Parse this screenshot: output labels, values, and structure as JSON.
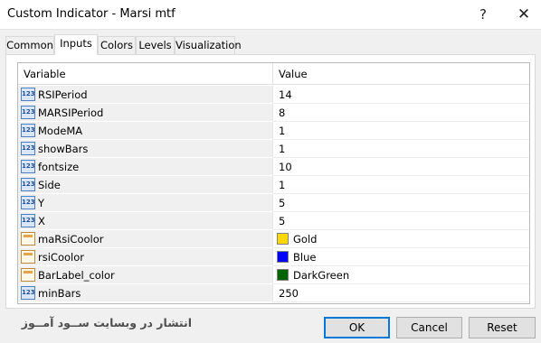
{
  "window": {
    "title": "Custom Indicator - Marsi mtf",
    "help_label": "?",
    "close_label": "✕"
  },
  "tabs": [
    {
      "label": "Common"
    },
    {
      "label": "Inputs",
      "active": true
    },
    {
      "label": "Colors"
    },
    {
      "label": "Levels"
    },
    {
      "label": "Visualization"
    }
  ],
  "grid": {
    "header_variable": "Variable",
    "header_value": "Value",
    "rows": [
      {
        "icon": "numeric-param-icon",
        "icon_text": "123",
        "name": "RSIPeriod",
        "value": "14"
      },
      {
        "icon": "numeric-param-icon",
        "icon_text": "123",
        "name": "MARSIPeriod",
        "value": "8"
      },
      {
        "icon": "numeric-param-icon",
        "icon_text": "123",
        "name": "ModeMA",
        "value": "1"
      },
      {
        "icon": "numeric-param-icon",
        "icon_text": "123",
        "name": "showBars",
        "value": "1"
      },
      {
        "icon": "numeric-param-icon",
        "icon_text": "123",
        "name": "fontsize",
        "value": "10"
      },
      {
        "icon": "numeric-param-icon",
        "icon_text": "123",
        "name": "Side",
        "value": "1"
      },
      {
        "icon": "numeric-param-icon",
        "icon_text": "123",
        "name": "Y",
        "value": "5"
      },
      {
        "icon": "numeric-param-icon",
        "icon_text": "123",
        "name": "X",
        "value": "5"
      },
      {
        "icon": "color-param-icon",
        "name": "maRsiCoolor",
        "value": "Gold",
        "color": "#ffd700"
      },
      {
        "icon": "color-param-icon",
        "name": "rsiCoolor",
        "value": "Blue",
        "color": "#0000ff"
      },
      {
        "icon": "color-param-icon",
        "name": "BarLabel_color",
        "value": "DarkGreen",
        "color": "#006400"
      },
      {
        "icon": "numeric-param-icon",
        "icon_text": "123",
        "name": "minBars",
        "value": "250"
      }
    ]
  },
  "footer": {
    "watermark_text": "انتشار در وبسایت ســود آمــوز",
    "ok_label": "OK",
    "cancel_label": "Cancel",
    "reset_label": "Reset"
  },
  "colors": {
    "accent": "#0078d7"
  }
}
